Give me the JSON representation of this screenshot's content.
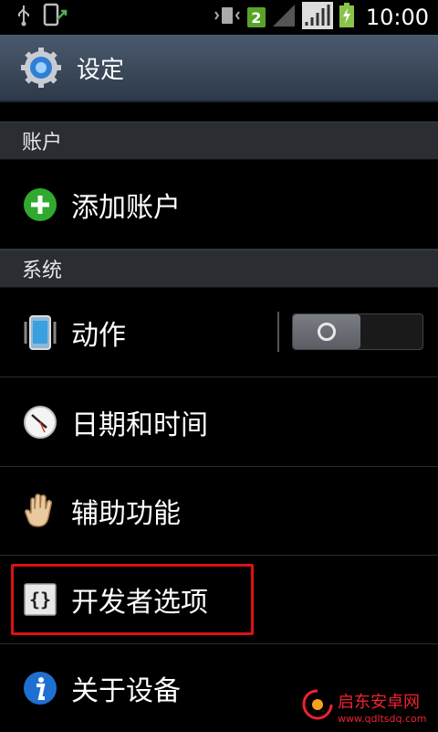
{
  "status": {
    "sim_badge": "2",
    "time": "10:00"
  },
  "header": {
    "title": "设定",
    "icon": "gear-icon"
  },
  "sections": [
    {
      "label": "账户"
    },
    {
      "label": "系统"
    }
  ],
  "items": [
    {
      "label": "添加账户",
      "icon": "add-icon"
    },
    {
      "label": "动作",
      "icon": "motion-phone-icon",
      "toggle": "off"
    },
    {
      "label": "日期和时间",
      "icon": "clock-icon"
    },
    {
      "label": "辅助功能",
      "icon": "hand-icon"
    },
    {
      "label": "开发者选项",
      "icon": "braces-icon"
    },
    {
      "label": "关于设备",
      "icon": "info-icon"
    }
  ],
  "watermark": {
    "cn": "启东安卓网",
    "url": "www.qdltsdq.com"
  },
  "colors": {
    "highlight": "#dd1111",
    "add_green": "#2faa2f",
    "info_blue": "#1f6fd0"
  }
}
